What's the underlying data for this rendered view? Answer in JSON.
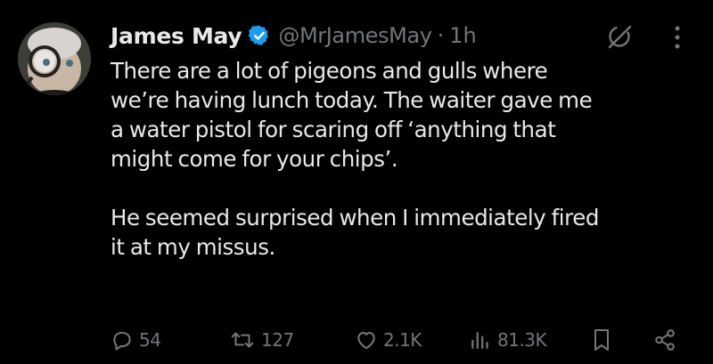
{
  "tweet": {
    "display_name": "James May",
    "handle": "@MrJamesMay",
    "separator": "·",
    "time": "1h",
    "body_lines": [
      "There are a lot of pigeons and gulls where",
      "we’re having lunch today. The waiter gave me",
      "a water pistol for scaring off ‘anything that",
      "might come for your chips’.",
      "",
      "He seemed surprised when I immediately fired",
      "it at my missus."
    ]
  },
  "actions": {
    "replies": "54",
    "reposts": "127",
    "likes": "2.1K",
    "views": "81.3K"
  },
  "icons": {
    "verified": "verified-badge-icon",
    "grok": "grok-icon",
    "more": "more-vertical-icon",
    "reply": "reply-icon",
    "repost": "repost-icon",
    "like": "heart-icon",
    "views": "views-icon",
    "bookmark": "bookmark-icon",
    "share": "share-icon"
  },
  "colors": {
    "background": "#000000",
    "text": "#e7e9ea",
    "muted": "#71767b",
    "verified": "#1d9bf0"
  }
}
